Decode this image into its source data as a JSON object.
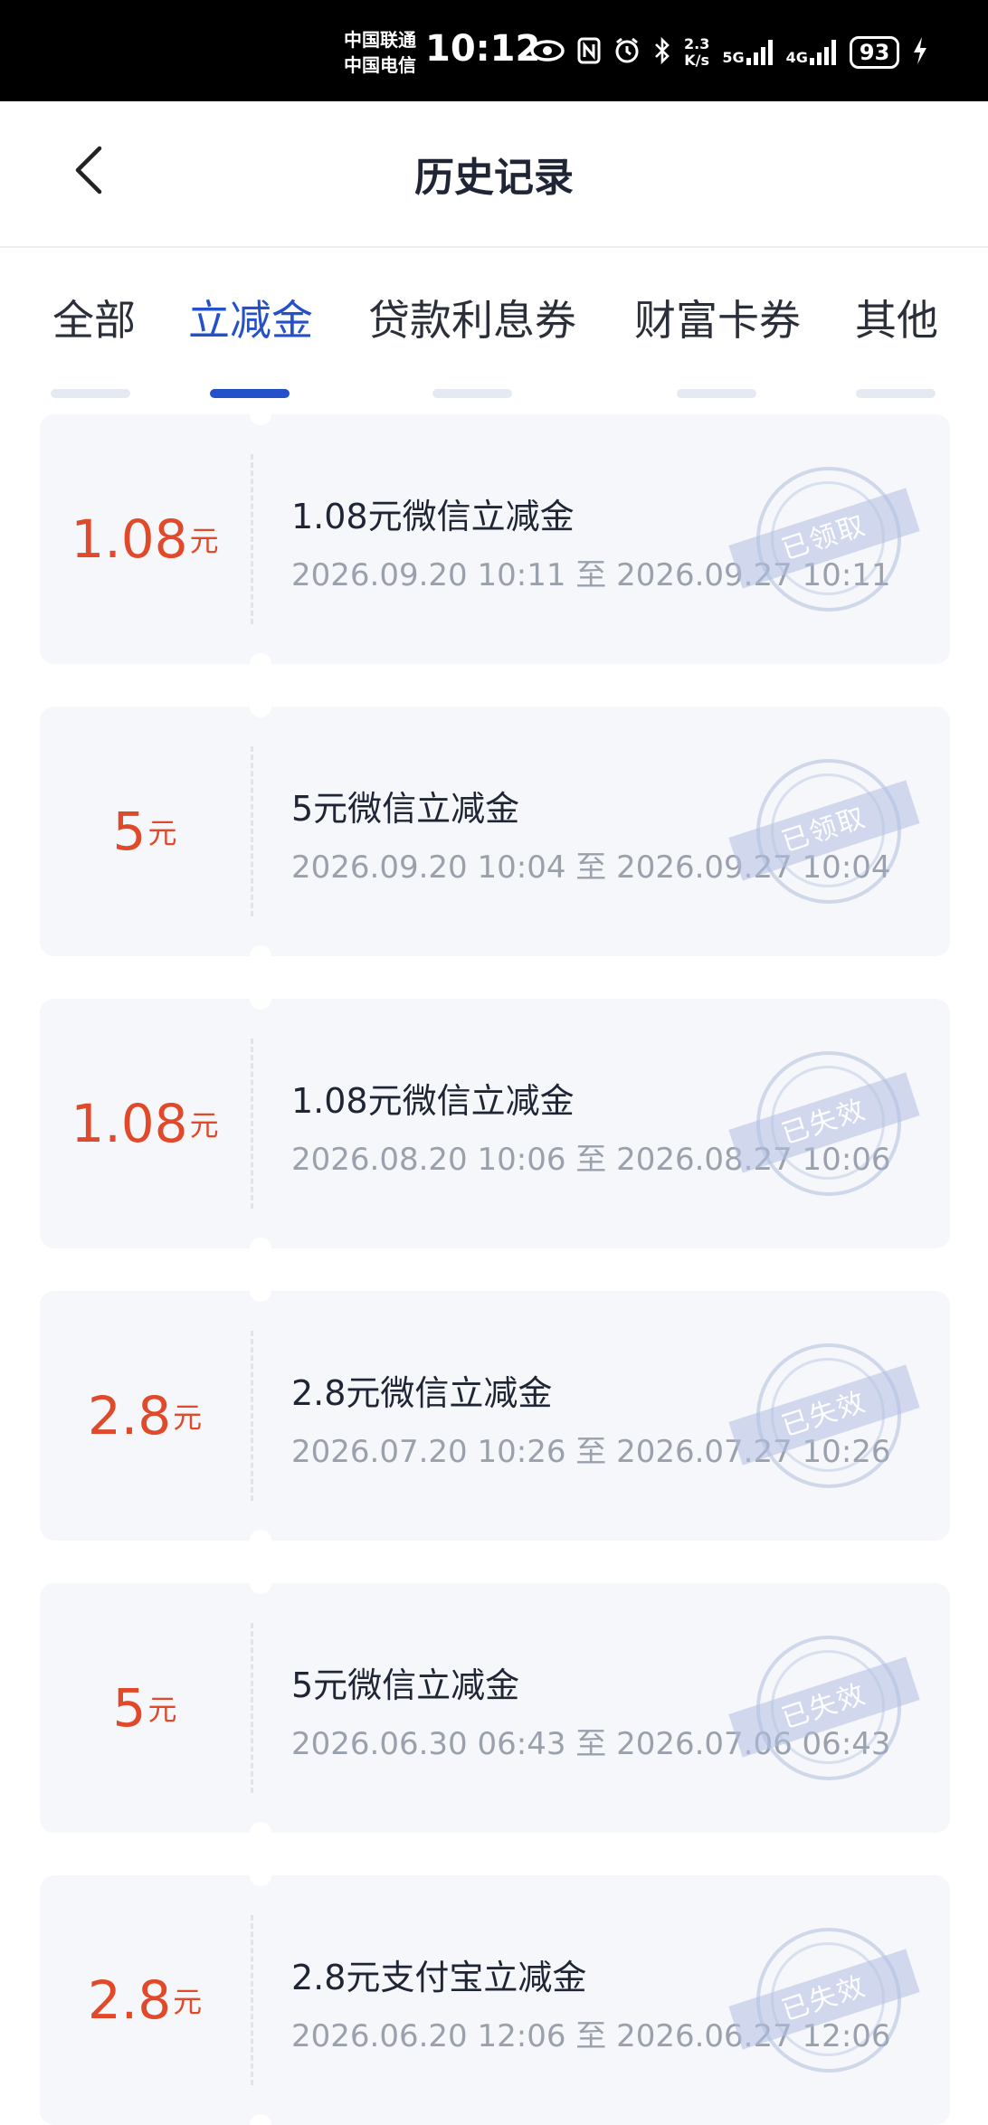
{
  "status_bar": {
    "carrier_1": "中国联通",
    "carrier_2": "中国电信",
    "time": "10:12",
    "net_speed_value": "2.3",
    "net_speed_unit": "K/s",
    "network_1": "5G",
    "network_2": "4G",
    "battery": "93"
  },
  "header": {
    "title": "历史记录",
    "back_icon": "chevron-left-icon"
  },
  "tabs": [
    {
      "label": "全部",
      "active": false
    },
    {
      "label": "立减金",
      "active": true
    },
    {
      "label": "贷款利息券",
      "active": false
    },
    {
      "label": "财富卡券",
      "active": false
    },
    {
      "label": "其他",
      "active": false
    }
  ],
  "colors": {
    "accent": "#2451c9",
    "amount": "#e04a2a",
    "card_bg": "#f5f7fa"
  },
  "coupons": [
    {
      "amount": "1.08",
      "unit": "元",
      "title": "1.08元微信立减金",
      "period": "2026.09.20 10:11 至 2026.09.27 10:11",
      "status": "已领取"
    },
    {
      "amount": "5",
      "unit": "元",
      "title": "5元微信立减金",
      "period": "2026.09.20 10:04 至 2026.09.27 10:04",
      "status": "已领取"
    },
    {
      "amount": "1.08",
      "unit": "元",
      "title": "1.08元微信立减金",
      "period": "2026.08.20 10:06 至 2026.08.27 10:06",
      "status": "已失效"
    },
    {
      "amount": "2.8",
      "unit": "元",
      "title": "2.8元微信立减金",
      "period": "2026.07.20 10:26 至 2026.07.27 10:26",
      "status": "已失效"
    },
    {
      "amount": "5",
      "unit": "元",
      "title": "5元微信立减金",
      "period": "2026.06.30 06:43 至 2026.07.06 06:43",
      "status": "已失效"
    },
    {
      "amount": "2.8",
      "unit": "元",
      "title": "2.8元支付宝立减金",
      "period": "2026.06.20 12:06 至 2026.06.27 12:06",
      "status": "已失效"
    }
  ]
}
